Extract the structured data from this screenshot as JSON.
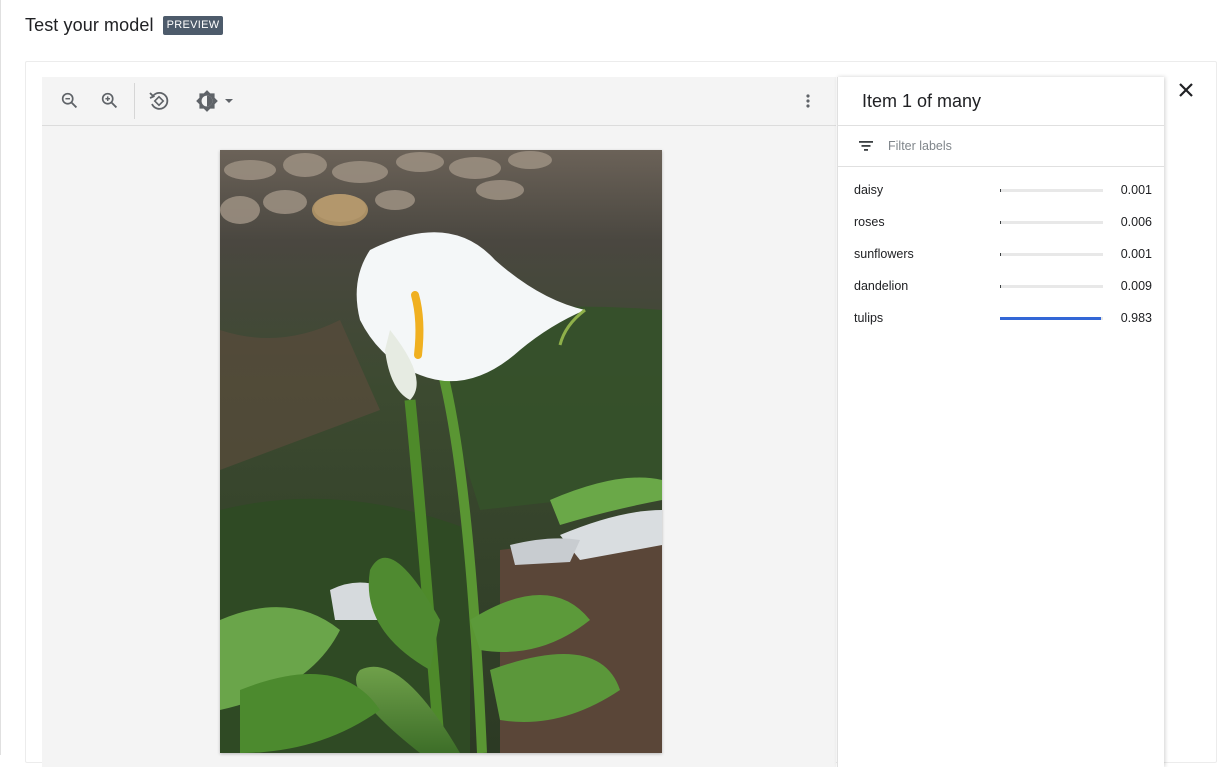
{
  "header": {
    "title": "Test your model",
    "badge": "PREVIEW"
  },
  "toolbar": {
    "icons": [
      "zoom-out-icon",
      "zoom-in-icon",
      "rotate-icon",
      "brightness-icon",
      "chevron-down-icon",
      "more-vert-icon"
    ]
  },
  "side_panel": {
    "item_count": "Item 1 of many",
    "filter": {
      "placeholder": "Filter labels",
      "value": ""
    },
    "labels": [
      {
        "name": "daisy",
        "score": "0.001",
        "fraction": 0.001
      },
      {
        "name": "roses",
        "score": "0.006",
        "fraction": 0.006
      },
      {
        "name": "sunflowers",
        "score": "0.001",
        "fraction": 0.001
      },
      {
        "name": "dandelion",
        "score": "0.009",
        "fraction": 0.009
      },
      {
        "name": "tulips",
        "score": "0.983",
        "fraction": 0.983
      }
    ]
  },
  "colors": {
    "accent": "#3367d6",
    "badge_bg": "#4d5b6b"
  }
}
